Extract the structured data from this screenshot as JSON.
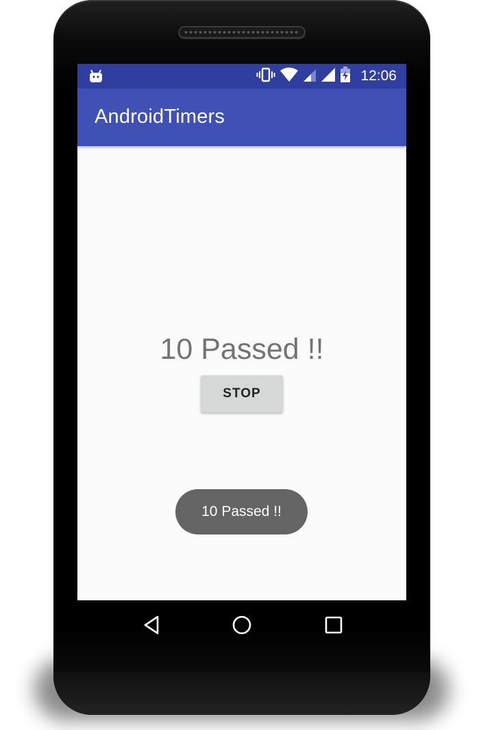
{
  "status_bar": {
    "time": "12:06",
    "icons": [
      "android-debug-icon",
      "vibrate-icon",
      "wifi-icon",
      "signal-icon",
      "signal-icon",
      "battery-charging-icon"
    ]
  },
  "app_bar": {
    "title": "AndroidTimers"
  },
  "main": {
    "counter_text": "10 Passed !!",
    "stop_button_label": "STOP"
  },
  "toast": {
    "message": "10 Passed !!"
  },
  "nav_bar": {
    "icons": [
      "back-icon",
      "home-icon",
      "recents-icon"
    ]
  },
  "colors": {
    "status_bar": "#303f9f",
    "app_bar": "#3f51b5",
    "screen_background": "#fafafa",
    "button": "#d6d7d7",
    "toast": "#646464",
    "counter_text": "#737373"
  }
}
